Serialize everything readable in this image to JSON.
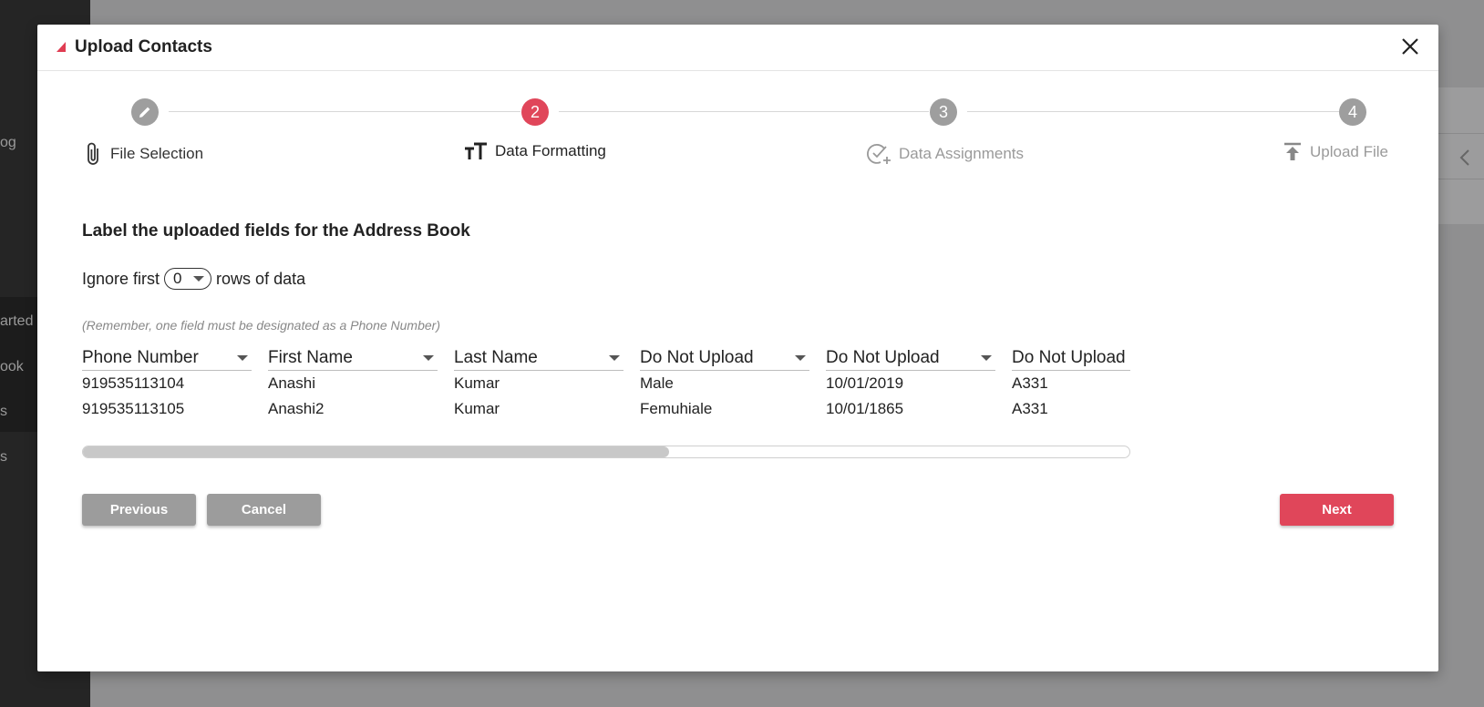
{
  "background": {
    "sidebar_items": [
      "og",
      "arted",
      "ook",
      "s",
      "s"
    ]
  },
  "modal": {
    "title": "Upload Contacts",
    "close_icon": "close-icon"
  },
  "stepper": {
    "steps": [
      {
        "number": "",
        "icon": "pencil-icon",
        "label": "File Selection",
        "label_icon": "paperclip-icon",
        "state": "done"
      },
      {
        "number": "2",
        "label": "Data Formatting",
        "label_icon": "text-size-icon",
        "state": "active"
      },
      {
        "number": "3",
        "label": "Data Assignments",
        "label_icon": "check-circle-plus-icon",
        "state": "pending"
      },
      {
        "number": "4",
        "label": "Upload File",
        "label_icon": "upload-icon",
        "state": "pending"
      }
    ]
  },
  "content": {
    "section_title": "Label the uploaded fields for the Address Book",
    "ignore_prefix": "Ignore first",
    "ignore_value": "0",
    "ignore_suffix": "rows of data",
    "hint": "(Remember, one field must be designated as a Phone Number)"
  },
  "table": {
    "columns": [
      {
        "header": "Phone Number",
        "cells": [
          "919535113104",
          "919535113105"
        ]
      },
      {
        "header": "First Name",
        "cells": [
          "Anashi",
          "Anashi2"
        ]
      },
      {
        "header": "Last Name",
        "cells": [
          "Kumar",
          "Kumar"
        ]
      },
      {
        "header": "Do Not Upload",
        "cells": [
          "Male",
          "Femuhiale"
        ]
      },
      {
        "header": "Do Not Upload",
        "cells": [
          "10/01/2019",
          "10/01/1865"
        ]
      },
      {
        "header": "Do Not Upload",
        "cells": [
          "A331",
          "A331"
        ]
      }
    ],
    "scroll_fraction": 0.56
  },
  "buttons": {
    "previous": "Previous",
    "cancel": "Cancel",
    "next": "Next"
  },
  "colors": {
    "accent": "#e0465a",
    "step_inactive": "#9e9e9e",
    "button_grey": "#9c9c9c"
  }
}
